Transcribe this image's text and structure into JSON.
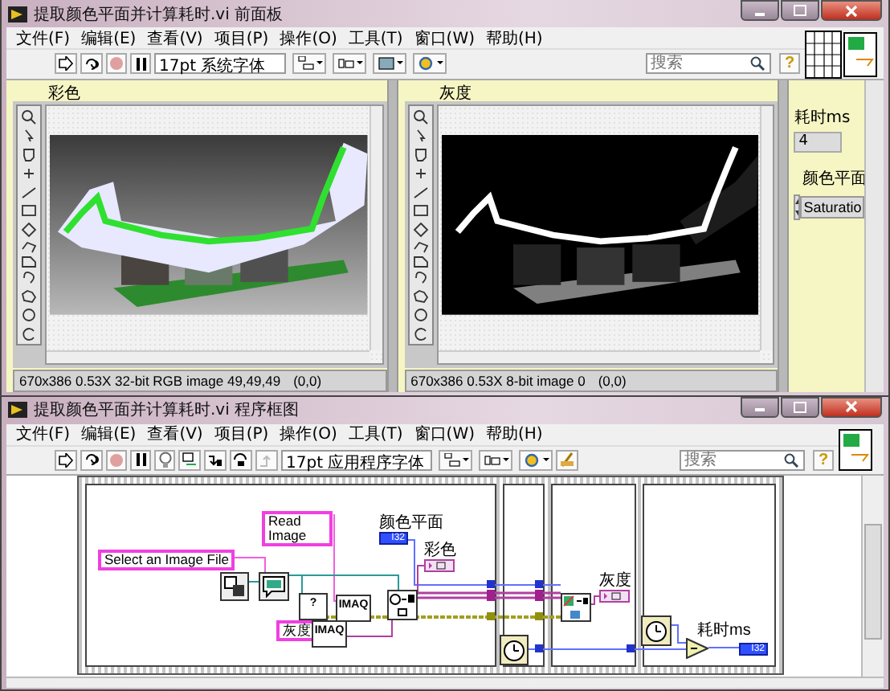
{
  "front_panel": {
    "title": "提取颜色平面并计算耗时.vi 前面板",
    "menu": [
      "文件(F)",
      "编辑(E)",
      "查看(V)",
      "项目(P)",
      "操作(O)",
      "工具(T)",
      "窗口(W)",
      "帮助(H)"
    ],
    "font": "17pt 系统字体",
    "search": {
      "placeholder": "搜索"
    },
    "help": "?",
    "displays": [
      {
        "label": "彩色",
        "kind": "color",
        "status": "670x386 0.53X 32-bit RGB image 49,49,49",
        "coords": "(0,0)"
      },
      {
        "label": "灰度",
        "kind": "gray",
        "status": "670x386 0.53X 8-bit image 0",
        "coords": "(0,0)"
      }
    ],
    "time_label": "耗时ms",
    "time_value": "4",
    "plane_label": "颜色平面",
    "plane_value": "Saturatio"
  },
  "block_diagram": {
    "title": "提取颜色平面并计算耗时.vi 程序框图",
    "menu": [
      "文件(F)",
      "编辑(E)",
      "查看(V)",
      "项目(P)",
      "操作(O)",
      "工具(T)",
      "窗口(W)",
      "帮助(H)"
    ],
    "font": "17pt 应用程序字体",
    "search": {
      "placeholder": "搜索"
    },
    "help": "?",
    "elements": [
      {
        "kind": "string",
        "text": "Select an Image File"
      },
      {
        "kind": "string",
        "text": "Read Image"
      },
      {
        "kind": "label",
        "text": "颜色平面"
      },
      {
        "kind": "numeric",
        "text": "I32"
      },
      {
        "kind": "label",
        "text": "彩色"
      },
      {
        "kind": "function",
        "text": "?"
      },
      {
        "kind": "function",
        "text": "IMAQ"
      },
      {
        "kind": "string",
        "text": "灰度"
      },
      {
        "kind": "function",
        "text": "IMAQ"
      },
      {
        "kind": "label",
        "text": "灰度"
      },
      {
        "kind": "label",
        "text": "耗时ms"
      },
      {
        "kind": "numeric",
        "text": "I32"
      }
    ]
  }
}
